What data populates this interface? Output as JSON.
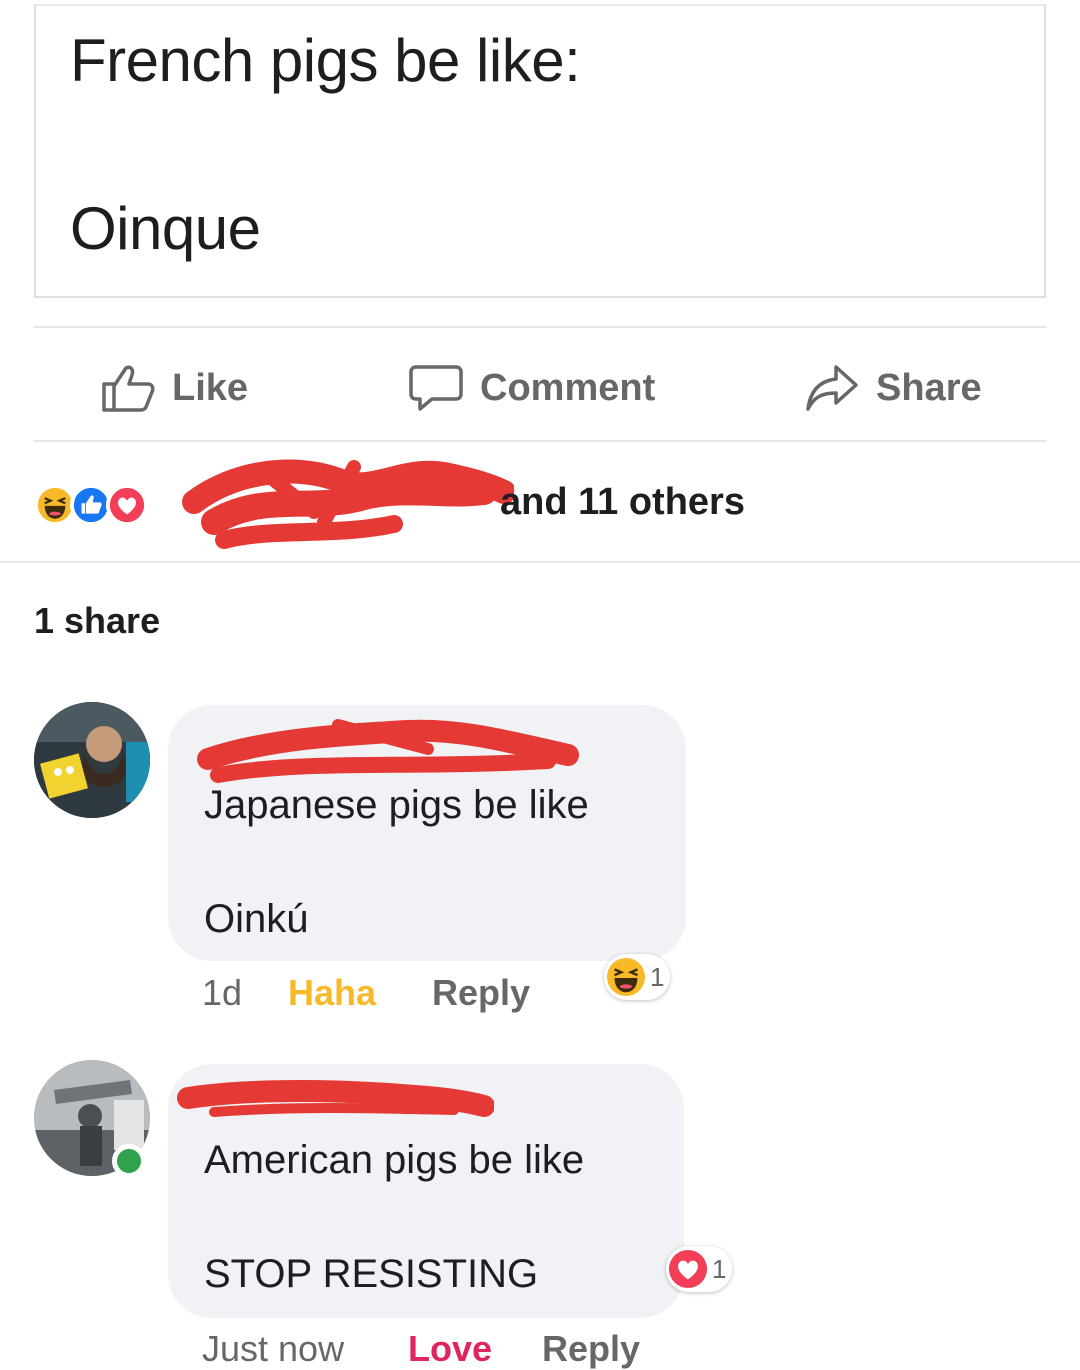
{
  "post": {
    "line1": "French pigs be like:",
    "line2": "Oinque"
  },
  "actions": {
    "like": "Like",
    "comment": "Comment",
    "share": "Share"
  },
  "reactions": {
    "summary": "and 11 others",
    "icons": [
      "haha-icon",
      "like-icon",
      "love-icon"
    ],
    "colors": {
      "haha": "#f7b928",
      "like": "#1877f2",
      "love": "#f33e58"
    }
  },
  "shares": "1 share",
  "comments": [
    {
      "line1": "Japanese pigs be like",
      "line2": "Oinkú",
      "time": "1d",
      "reaction_label": "Haha",
      "reply": "Reply",
      "reaction_count": "1",
      "reaction_icon": "haha-icon"
    },
    {
      "line1": "American pigs be like",
      "line2": "STOP RESISTING",
      "time": "Just now",
      "reaction_label": "Love",
      "reply": "Reply",
      "reaction_count": "1",
      "reaction_icon": "love-icon"
    }
  ],
  "redaction_color": "#e53935"
}
